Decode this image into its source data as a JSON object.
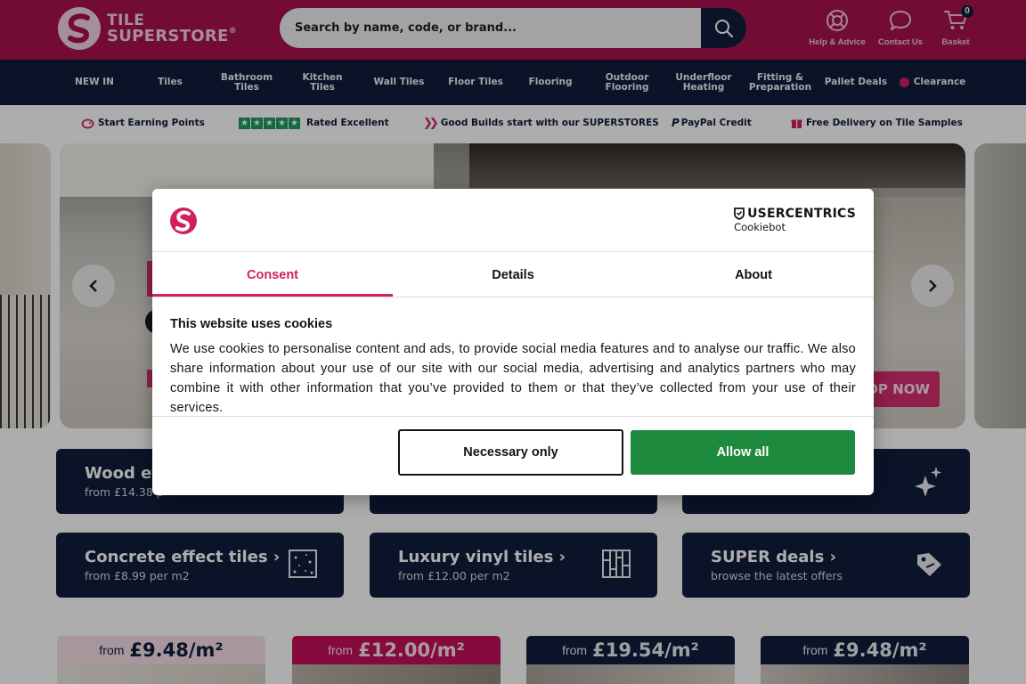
{
  "header": {
    "logo_line1": "TILE",
    "logo_line2": "SUPERSTORE",
    "logo_reg": "®",
    "search_placeholder": "Search by name, code, or brand...",
    "help_label": "Help & Advice",
    "contact_label": "Contact Us",
    "basket_label": "Basket",
    "basket_count": "0",
    "colors": {
      "brand": "#a8124f",
      "navy": "#0f1d3b"
    }
  },
  "nav": {
    "items": [
      "NEW IN",
      "Tiles",
      "Bathroom\nTiles",
      "Kitchen\nTiles",
      "Wall Tiles",
      "Floor Tiles",
      "Flooring",
      "Outdoor\nFlooring",
      "Underfloor\nHeating",
      "Fitting &\nPreparation",
      "Pallet Deals",
      "Clearance"
    ]
  },
  "usp": {
    "items": [
      "Start Earning Points",
      "Rated Excellent",
      "Good Builds start with our SUPERSTORES",
      "PayPal Credit",
      "Free Delivery on Tile Samples"
    ]
  },
  "hero": {
    "cta": "OP NOW"
  },
  "categories": [
    {
      "title": "Wood ef",
      "sub": "from £14.38 p",
      "icon": "wood-icon"
    },
    {
      "title": "",
      "sub": "",
      "icon": ""
    },
    {
      "title": "",
      "sub": "",
      "icon": "sparkle-icon"
    },
    {
      "title": "Concrete effect tiles",
      "sub": "from £8.99 per m2",
      "icon": "concrete-icon"
    },
    {
      "title": "Luxury vinyl tiles",
      "sub": "from £12.00 per m2",
      "icon": "vinyl-planks-icon"
    },
    {
      "title": "SUPER deals",
      "sub": "browse the latest offers",
      "icon": "price-tag-icon"
    }
  ],
  "price_cards": [
    {
      "from": "from",
      "price": "£9.48/m²"
    },
    {
      "from": "from",
      "price": "£12.00/m²"
    },
    {
      "from": "from",
      "price": "£19.54/m²"
    },
    {
      "from": "from",
      "price": "£9.48/m²"
    }
  ],
  "cookie_dialog": {
    "brand_line1": "USERCENTRICS",
    "brand_line2": "Cookiebot",
    "tabs": [
      "Consent",
      "Details",
      "About"
    ],
    "title": "This website uses cookies",
    "body": "We use cookies to personalise content and ads, to provide social media features and to analyse our traffic. We also share information about your use of our site with our social media, advertising and analytics partners who may combine it with other information that you’ve provided to them or that they’ve collected from your use of their services.",
    "btn_necessary": "Necessary only",
    "btn_allow": "Allow all",
    "colors": {
      "accent": "#d0215e",
      "allow": "#1e8a3e"
    }
  }
}
